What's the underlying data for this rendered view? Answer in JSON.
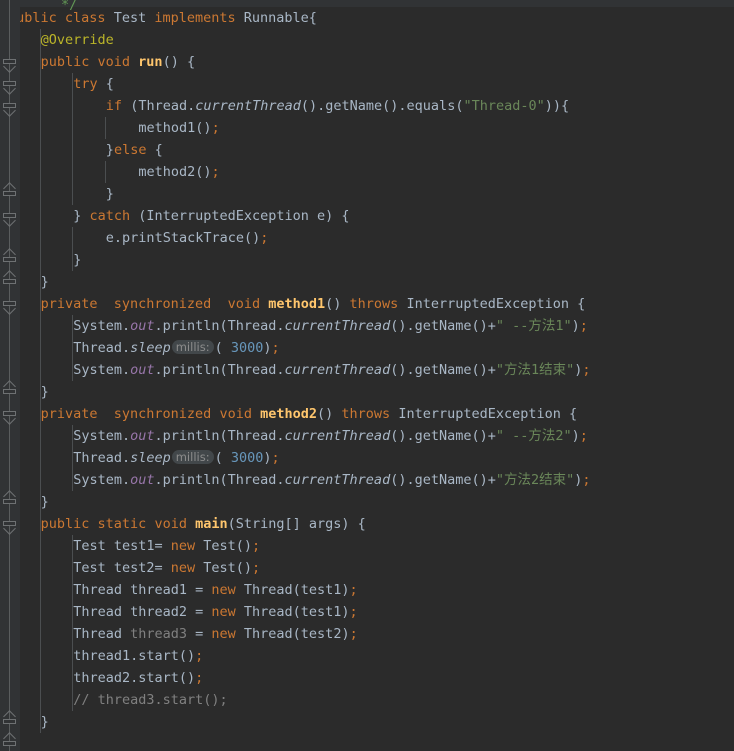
{
  "editor": {
    "theme": "darcula",
    "background": "#2B2B2B",
    "gutter_background": "#313335",
    "default_text_color": "#A9B7C6",
    "colors": {
      "keyword": "#CC7832",
      "string": "#6A8759",
      "number": "#6897BB",
      "method": "#FFC66D",
      "static_field": "#9876AA",
      "comment": "#808080",
      "annotation": "#BBB529",
      "unused": "#808080",
      "indent_guide": "#4B4E50",
      "inlay_hint_bg": "#42474A",
      "inlay_hint_fg": "#8C8C8C"
    },
    "clipped_comment_fragment": "*/",
    "language": "java",
    "file_class_name": "Test"
  },
  "inlay_hints": {
    "millis_label": "millis:"
  },
  "code_lines": [
    {
      "indent": 0,
      "tokens": [
        {
          "t": "public",
          "c": "kw"
        },
        {
          "t": " ",
          "c": "plain"
        },
        {
          "t": "class",
          "c": "kw"
        },
        {
          "t": " ",
          "c": "plain"
        },
        {
          "t": "Test",
          "c": "clsb"
        },
        {
          "t": " ",
          "c": "plain"
        },
        {
          "t": "implements",
          "c": "kw"
        },
        {
          "t": " ",
          "c": "plain"
        },
        {
          "t": "Runnable{",
          "c": "plain"
        }
      ]
    },
    {
      "indent": 1,
      "tokens": [
        {
          "t": "@Override",
          "c": "anno"
        }
      ]
    },
    {
      "indent": 1,
      "tokens": [
        {
          "t": "public",
          "c": "kw"
        },
        {
          "t": " ",
          "c": "plain"
        },
        {
          "t": "void",
          "c": "kw"
        },
        {
          "t": " ",
          "c": "plain"
        },
        {
          "t": "run",
          "c": "mthb"
        },
        {
          "t": "() {",
          "c": "plain"
        }
      ]
    },
    {
      "indent": 2,
      "tokens": [
        {
          "t": "try",
          "c": "kw"
        },
        {
          "t": " {",
          "c": "plain"
        }
      ]
    },
    {
      "indent": 3,
      "tokens": [
        {
          "t": "if",
          "c": "kw"
        },
        {
          "t": " (Thread.",
          "c": "plain"
        },
        {
          "t": "currentThread",
          "c": "statm"
        },
        {
          "t": "().getName().equals(",
          "c": "plain"
        },
        {
          "t": "\"Thread-0\"",
          "c": "str"
        },
        {
          "t": ")){",
          "c": "plain"
        }
      ]
    },
    {
      "indent": 4,
      "tokens": [
        {
          "t": "method1",
          "c": "plain"
        },
        {
          "t": "()",
          "c": "plain"
        },
        {
          "t": ";",
          "c": "kw"
        }
      ]
    },
    {
      "indent": 3,
      "tokens": [
        {
          "t": "}",
          "c": "plain"
        },
        {
          "t": "else",
          "c": "kw"
        },
        {
          "t": " {",
          "c": "plain"
        }
      ]
    },
    {
      "indent": 4,
      "tokens": [
        {
          "t": "method2()",
          "c": "plain"
        },
        {
          "t": ";",
          "c": "kw"
        }
      ]
    },
    {
      "indent": 3,
      "tokens": [
        {
          "t": "}",
          "c": "plain"
        }
      ]
    },
    {
      "indent": 2,
      "tokens": [
        {
          "t": "} ",
          "c": "plain"
        },
        {
          "t": "catch",
          "c": "kw"
        },
        {
          "t": " (InterruptedException e) {",
          "c": "plain"
        }
      ]
    },
    {
      "indent": 3,
      "tokens": [
        {
          "t": "e.printStackTrace()",
          "c": "plain"
        },
        {
          "t": ";",
          "c": "kw"
        }
      ]
    },
    {
      "indent": 2,
      "tokens": [
        {
          "t": "}",
          "c": "plain"
        }
      ]
    },
    {
      "indent": 1,
      "tokens": [
        {
          "t": "}",
          "c": "plain"
        }
      ]
    },
    {
      "indent": 1,
      "tokens": [
        {
          "t": "private",
          "c": "kw"
        },
        {
          "t": "  ",
          "c": "plain"
        },
        {
          "t": "synchronized",
          "c": "kw"
        },
        {
          "t": "  ",
          "c": "plain"
        },
        {
          "t": "void",
          "c": "kw"
        },
        {
          "t": " ",
          "c": "plain"
        },
        {
          "t": "method1",
          "c": "mthb"
        },
        {
          "t": "() ",
          "c": "plain"
        },
        {
          "t": "throws",
          "c": "kw"
        },
        {
          "t": " InterruptedException {",
          "c": "plain"
        }
      ]
    },
    {
      "indent": 2,
      "tokens": [
        {
          "t": "System.",
          "c": "plain"
        },
        {
          "t": "out",
          "c": "stat"
        },
        {
          "t": ".println(Thread.",
          "c": "plain"
        },
        {
          "t": "currentThread",
          "c": "statm"
        },
        {
          "t": "().getName()+",
          "c": "plain"
        },
        {
          "t": "\" --方法1\"",
          "c": "str"
        },
        {
          "t": ")",
          "c": "plain"
        },
        {
          "t": ";",
          "c": "kw"
        }
      ]
    },
    {
      "indent": 2,
      "hint_after": 1,
      "tokens": [
        {
          "t": "Thread.",
          "c": "plain"
        },
        {
          "t": "sleep",
          "c": "statm"
        },
        {
          "t": "( ",
          "c": "plain"
        },
        {
          "t": "3000",
          "c": "num"
        },
        {
          "t": ")",
          "c": "plain"
        },
        {
          "t": ";",
          "c": "kw"
        }
      ]
    },
    {
      "indent": 2,
      "tokens": [
        {
          "t": "System.",
          "c": "plain"
        },
        {
          "t": "out",
          "c": "stat"
        },
        {
          "t": ".println(Thread.",
          "c": "plain"
        },
        {
          "t": "currentThread",
          "c": "statm"
        },
        {
          "t": "().getName()+",
          "c": "plain"
        },
        {
          "t": "\"方法1结束\"",
          "c": "str"
        },
        {
          "t": ")",
          "c": "plain"
        },
        {
          "t": ";",
          "c": "kw"
        }
      ]
    },
    {
      "indent": 1,
      "tokens": [
        {
          "t": "}",
          "c": "plain"
        }
      ]
    },
    {
      "indent": 1,
      "tokens": [
        {
          "t": "private",
          "c": "kw"
        },
        {
          "t": "  ",
          "c": "plain"
        },
        {
          "t": "synchronized",
          "c": "kw"
        },
        {
          "t": " ",
          "c": "plain"
        },
        {
          "t": "void",
          "c": "kw"
        },
        {
          "t": " ",
          "c": "plain"
        },
        {
          "t": "method2",
          "c": "mthb"
        },
        {
          "t": "() ",
          "c": "plain"
        },
        {
          "t": "throws",
          "c": "kw"
        },
        {
          "t": " InterruptedException {",
          "c": "plain"
        }
      ]
    },
    {
      "indent": 2,
      "tokens": [
        {
          "t": "System.",
          "c": "plain"
        },
        {
          "t": "out",
          "c": "stat"
        },
        {
          "t": ".println(Thread.",
          "c": "plain"
        },
        {
          "t": "currentThread",
          "c": "statm"
        },
        {
          "t": "().getName()+",
          "c": "plain"
        },
        {
          "t": "\" --方法2\"",
          "c": "str"
        },
        {
          "t": ")",
          "c": "plain"
        },
        {
          "t": ";",
          "c": "kw"
        }
      ]
    },
    {
      "indent": 2,
      "hint_after": 1,
      "tokens": [
        {
          "t": "Thread.",
          "c": "plain"
        },
        {
          "t": "sleep",
          "c": "statm"
        },
        {
          "t": "( ",
          "c": "plain"
        },
        {
          "t": "3000",
          "c": "num"
        },
        {
          "t": ")",
          "c": "plain"
        },
        {
          "t": ";",
          "c": "kw"
        }
      ]
    },
    {
      "indent": 2,
      "tokens": [
        {
          "t": "System.",
          "c": "plain"
        },
        {
          "t": "out",
          "c": "stat"
        },
        {
          "t": ".println(Thread.",
          "c": "plain"
        },
        {
          "t": "currentThread",
          "c": "statm"
        },
        {
          "t": "().getName()+",
          "c": "plain"
        },
        {
          "t": "\"方法2结束\"",
          "c": "str"
        },
        {
          "t": ")",
          "c": "plain"
        },
        {
          "t": ";",
          "c": "kw"
        }
      ]
    },
    {
      "indent": 1,
      "tokens": [
        {
          "t": "}",
          "c": "plain"
        }
      ]
    },
    {
      "indent": 1,
      "tokens": [
        {
          "t": "public",
          "c": "kw"
        },
        {
          "t": " ",
          "c": "plain"
        },
        {
          "t": "static",
          "c": "kw"
        },
        {
          "t": " ",
          "c": "plain"
        },
        {
          "t": "void",
          "c": "kw"
        },
        {
          "t": " ",
          "c": "plain"
        },
        {
          "t": "main",
          "c": "mthb"
        },
        {
          "t": "(String[] args) {",
          "c": "plain"
        }
      ]
    },
    {
      "indent": 2,
      "tokens": [
        {
          "t": "Test test1= ",
          "c": "plain"
        },
        {
          "t": "new",
          "c": "kw"
        },
        {
          "t": " Test()",
          "c": "plain"
        },
        {
          "t": ";",
          "c": "kw"
        }
      ]
    },
    {
      "indent": 2,
      "tokens": [
        {
          "t": "Test test2= ",
          "c": "plain"
        },
        {
          "t": "new",
          "c": "kw"
        },
        {
          "t": " Test()",
          "c": "plain"
        },
        {
          "t": ";",
          "c": "kw"
        }
      ]
    },
    {
      "indent": 2,
      "tokens": [
        {
          "t": "Thread thread1 = ",
          "c": "plain"
        },
        {
          "t": "new",
          "c": "kw"
        },
        {
          "t": " Thread(test1)",
          "c": "plain"
        },
        {
          "t": ";",
          "c": "kw"
        }
      ]
    },
    {
      "indent": 2,
      "tokens": [
        {
          "t": "Thread thread2 = ",
          "c": "plain"
        },
        {
          "t": "new",
          "c": "kw"
        },
        {
          "t": " Thread(test1)",
          "c": "plain"
        },
        {
          "t": ";",
          "c": "kw"
        }
      ]
    },
    {
      "indent": 2,
      "tokens": [
        {
          "t": "Thread ",
          "c": "plain"
        },
        {
          "t": "thread3",
          "c": "gray"
        },
        {
          "t": " = ",
          "c": "plain"
        },
        {
          "t": "new",
          "c": "kw"
        },
        {
          "t": " Thread(test2)",
          "c": "plain"
        },
        {
          "t": ";",
          "c": "kw"
        }
      ]
    },
    {
      "indent": 2,
      "tokens": [
        {
          "t": "thread1.start()",
          "c": "plain"
        },
        {
          "t": ";",
          "c": "kw"
        }
      ]
    },
    {
      "indent": 2,
      "tokens": [
        {
          "t": "thread2.start()",
          "c": "plain"
        },
        {
          "t": ";",
          "c": "kw"
        }
      ]
    },
    {
      "indent": 2,
      "tokens": [
        {
          "t": "// thread3.start();",
          "c": "cmt"
        }
      ]
    },
    {
      "indent": 1,
      "tokens": [
        {
          "t": "}",
          "c": "plain"
        }
      ]
    },
    {
      "indent": 0,
      "tokens": [
        {
          "t": "}",
          "c": "plain"
        }
      ]
    }
  ],
  "fold_markers": [
    {
      "line": 2,
      "dir": "down"
    },
    {
      "line": 3,
      "dir": "down"
    },
    {
      "line": 4,
      "dir": "down"
    },
    {
      "line": 8,
      "dir": "up"
    },
    {
      "line": 9,
      "dir": "down"
    },
    {
      "line": 11,
      "dir": "up"
    },
    {
      "line": 12,
      "dir": "up"
    },
    {
      "line": 13,
      "dir": "down"
    },
    {
      "line": 17,
      "dir": "up"
    },
    {
      "line": 18,
      "dir": "down"
    },
    {
      "line": 22,
      "dir": "up"
    },
    {
      "line": 23,
      "dir": "down"
    },
    {
      "line": 32,
      "dir": "up"
    },
    {
      "line": 33,
      "dir": "up"
    }
  ],
  "indent_guides": [
    {
      "indent": 1,
      "from_line": 1,
      "to_line": 32
    },
    {
      "indent": 2,
      "from_line": 3,
      "to_line": 3
    },
    {
      "indent": 2,
      "from_line": 4,
      "to_line": 8
    },
    {
      "indent": 3,
      "from_line": 5,
      "to_line": 5
    },
    {
      "indent": 3,
      "from_line": 7,
      "to_line": 7
    },
    {
      "indent": 2,
      "from_line": 10,
      "to_line": 11
    },
    {
      "indent": 2,
      "from_line": 14,
      "to_line": 16
    },
    {
      "indent": 2,
      "from_line": 19,
      "to_line": 21
    },
    {
      "indent": 2,
      "from_line": 24,
      "to_line": 31
    }
  ]
}
